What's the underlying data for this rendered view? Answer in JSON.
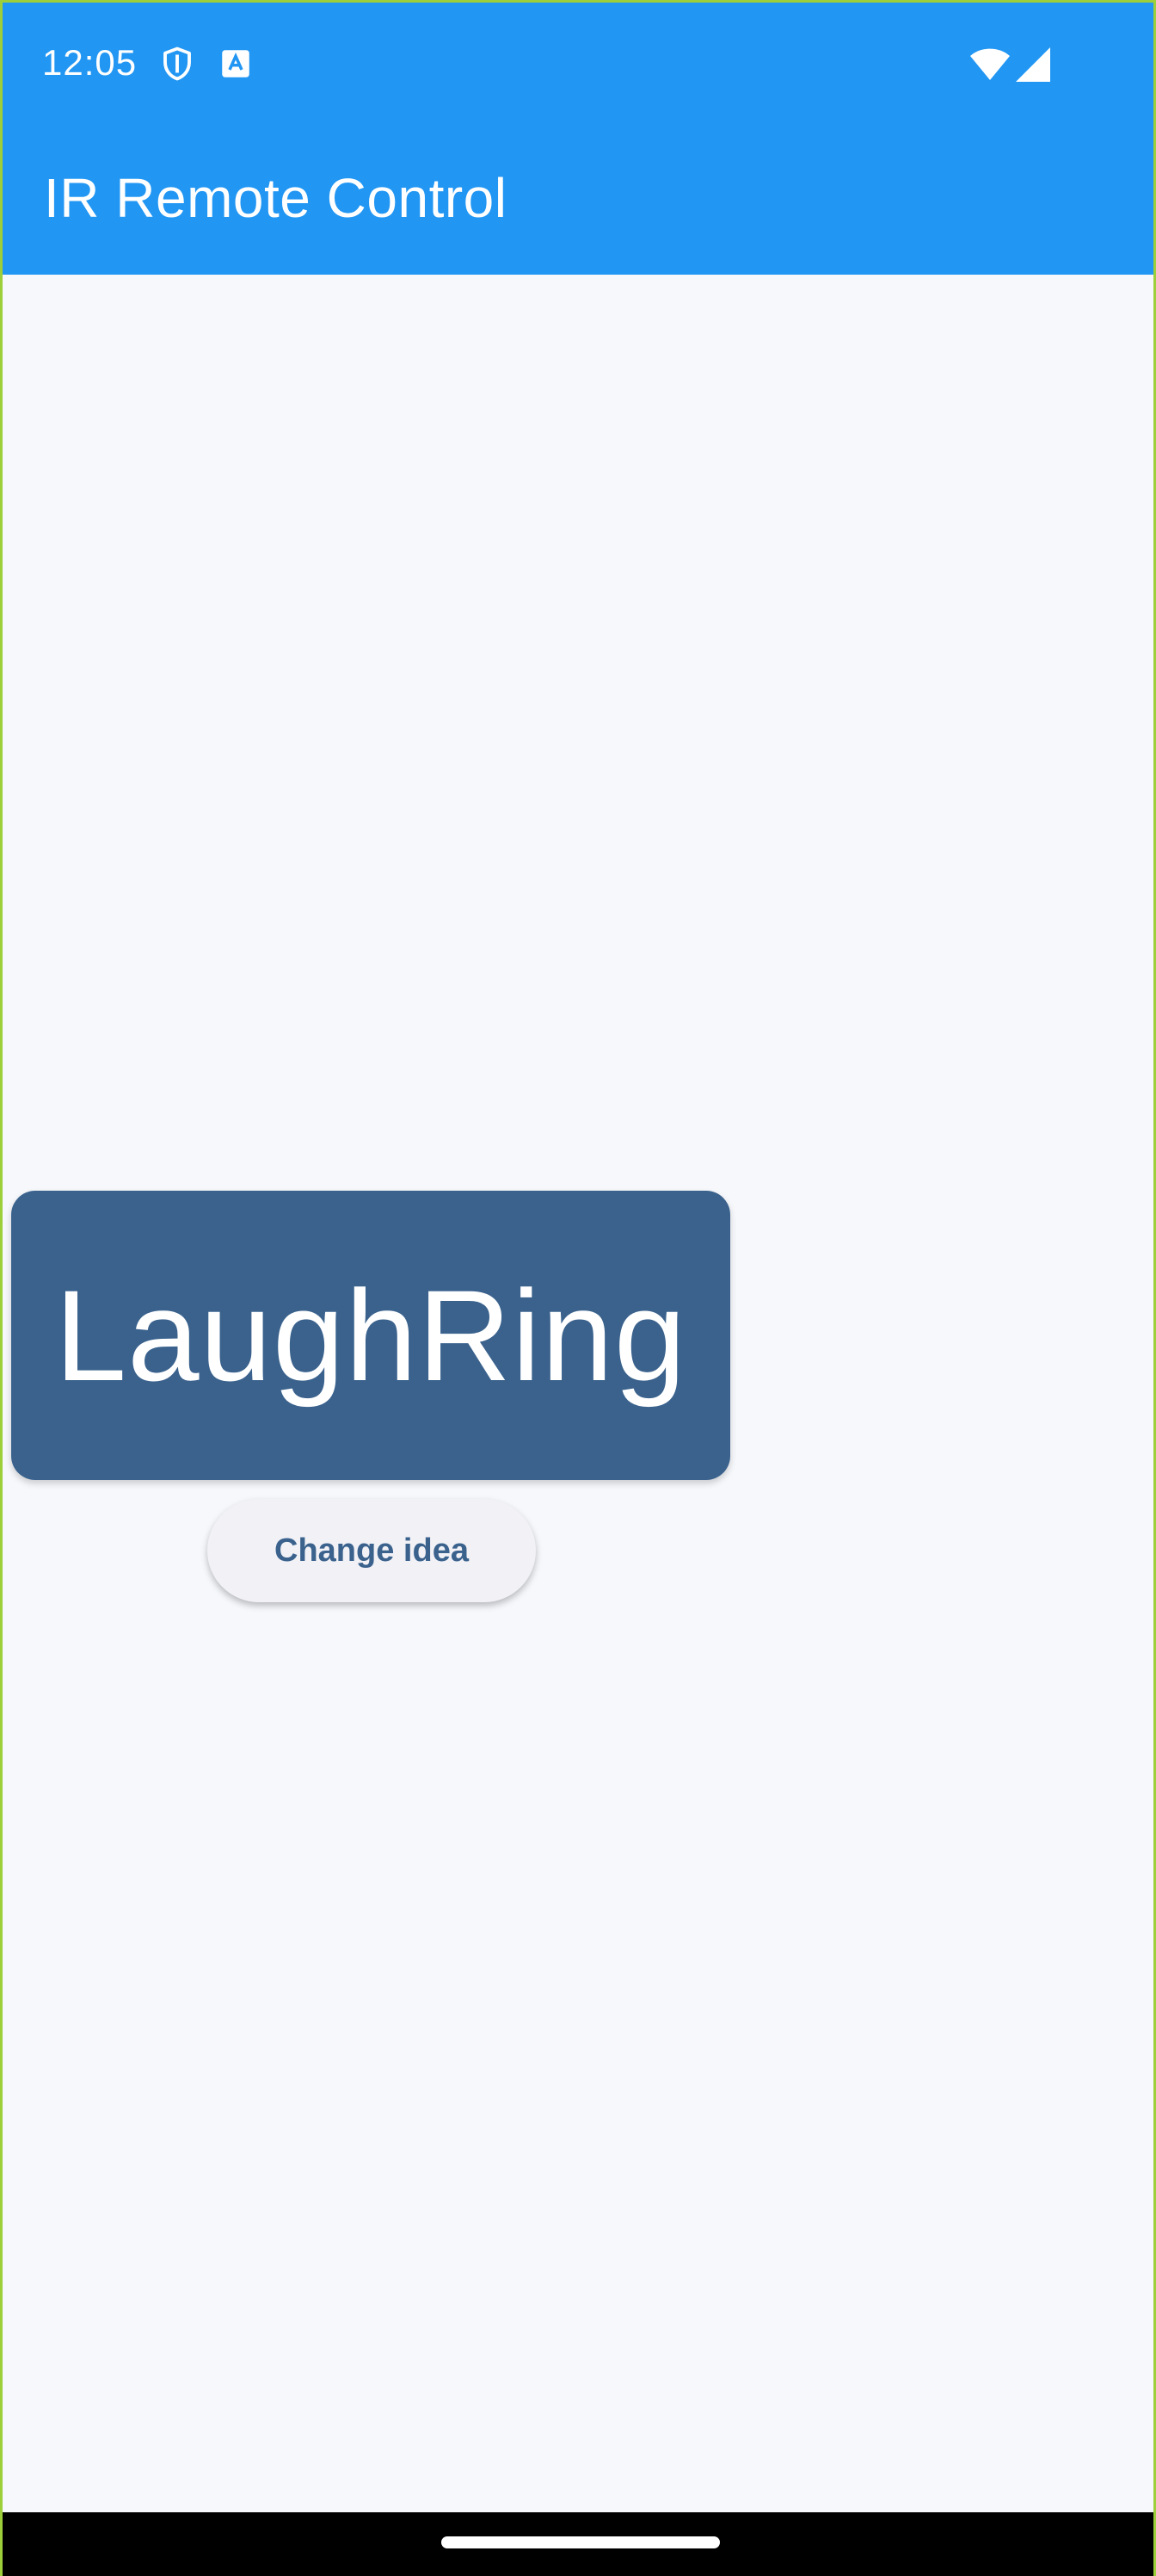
{
  "status_bar": {
    "time": "12:05",
    "icons": [
      "shield-icon",
      "text-a-icon",
      "wifi-icon",
      "signal-icon"
    ]
  },
  "app_bar": {
    "title": "IR Remote Control"
  },
  "main": {
    "idea": "LaughRing",
    "change_button_label": "Change idea"
  },
  "colors": {
    "app_bar": "#2196f3",
    "background": "#f6f8fc",
    "card": "#3a628d",
    "button_bg": "#f1f1f6",
    "button_text": "#3a628d",
    "nav_bar": "#000000"
  }
}
